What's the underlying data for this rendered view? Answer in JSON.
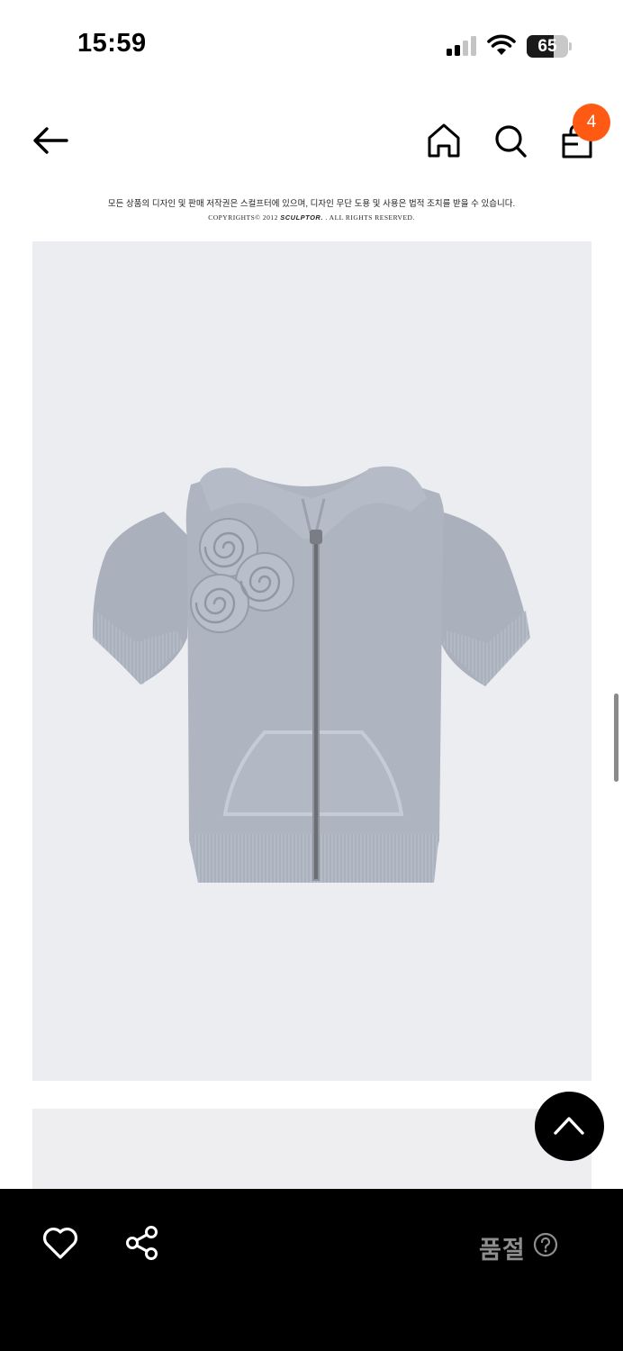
{
  "status_bar": {
    "time": "15:59",
    "battery_level": "65",
    "battery_percent": 65
  },
  "nav": {
    "icons": [
      "back-arrow-icon",
      "home-icon",
      "search-icon",
      "shopping-bag-icon"
    ],
    "cart_count": "4",
    "badge_color": "#ff5a14"
  },
  "copyright": {
    "line1": "모든 상품의 디자인 및 판매 저작권은 스컬프터에 있으며, 디자인 무단 도용 및 사용은 법적 조치를 받을 수 있습니다.",
    "line2_prefix": "COPYRIGHTS© 2012 ",
    "brand": "SCULPTOR.",
    "line2_suffix": " . ALL RIGHTS RESERVED."
  },
  "product": {
    "image": "light-blue-grey-short-sleeve-zip-hoodie-with-rose-appliques",
    "background_color": "#ecedf1"
  },
  "bottom_bar": {
    "icons": [
      "heart-icon",
      "share-icon",
      "help-icon"
    ],
    "status_label": "품절",
    "status_color": "#8e8e8e"
  }
}
